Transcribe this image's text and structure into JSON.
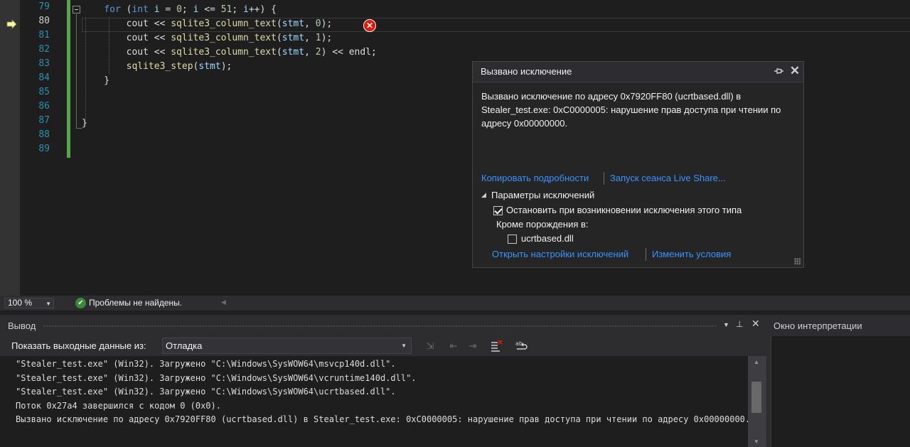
{
  "editor": {
    "line_numbers": [
      "79",
      "80",
      "81",
      "82",
      "83",
      "84",
      "85",
      "86",
      "87",
      "88",
      "89"
    ],
    "current_line": "80",
    "lines": [
      [
        {
          "t": "    "
        },
        {
          "t": "for",
          "c": "kw"
        },
        {
          "t": " ("
        },
        {
          "t": "int",
          "c": "kw"
        },
        {
          "t": " "
        },
        {
          "t": "i",
          "c": "var"
        },
        {
          "t": " = "
        },
        {
          "t": "0",
          "c": "num"
        },
        {
          "t": "; "
        },
        {
          "t": "i",
          "c": "var"
        },
        {
          "t": " <= "
        },
        {
          "t": "51",
          "c": "num"
        },
        {
          "t": "; "
        },
        {
          "t": "i",
          "c": "var"
        },
        {
          "t": "++) {"
        }
      ],
      [
        {
          "t": "        cout << "
        },
        {
          "t": "sqlite3_column_text",
          "c": "fn"
        },
        {
          "t": "("
        },
        {
          "t": "stmt",
          "c": "var"
        },
        {
          "t": ", "
        },
        {
          "t": "0",
          "c": "num"
        },
        {
          "t": ");"
        }
      ],
      [
        {
          "t": "        cout << "
        },
        {
          "t": "sqlite3_column_text",
          "c": "fn"
        },
        {
          "t": "("
        },
        {
          "t": "stmt",
          "c": "var"
        },
        {
          "t": ", "
        },
        {
          "t": "1",
          "c": "num"
        },
        {
          "t": ");"
        }
      ],
      [
        {
          "t": "        cout << "
        },
        {
          "t": "sqlite3_column_text",
          "c": "fn"
        },
        {
          "t": "("
        },
        {
          "t": "stmt",
          "c": "var"
        },
        {
          "t": ", "
        },
        {
          "t": "2",
          "c": "num"
        },
        {
          "t": ") << endl;"
        }
      ],
      [
        {
          "t": "        "
        },
        {
          "t": "sqlite3_step",
          "c": "fn"
        },
        {
          "t": "("
        },
        {
          "t": "stmt",
          "c": "var"
        },
        {
          "t": ");"
        }
      ],
      [
        {
          "t": "    }"
        }
      ],
      [
        {
          "t": ""
        }
      ],
      [
        {
          "t": ""
        }
      ],
      [
        {
          "t": "}"
        }
      ],
      [
        {
          "t": ""
        }
      ],
      [
        {
          "t": ""
        }
      ]
    ]
  },
  "exception": {
    "title": "Вызвано исключение",
    "message": "Вызвано исключение по адресу 0x7920FF80 (ucrtbased.dll) в Stealer_test.exe: 0xC0000005: нарушение прав доступа при чтении по адресу 0x00000000.",
    "link_copy": "Копировать подробности",
    "link_liveshare": "Запуск сеанса Live Share...",
    "params_title": "Параметры исключений",
    "break_label": "Остановить при возникновении исключения этого типа",
    "break_checked": true,
    "except_label": "Кроме порождения в:",
    "module_label": "ucrtbased.dll",
    "module_checked": false,
    "link_settings": "Открыть настройки исключений",
    "link_conditions": "Изменить условия",
    "pin_icon": "pin-icon",
    "close_icon": "close-icon"
  },
  "status": {
    "zoom": "100 %",
    "problems": "Проблемы не найдены."
  },
  "output": {
    "title": "Вывод",
    "source_label": "Показать выходные данные из:",
    "source_value": "Отладка",
    "lines": [
      "\"Stealer_test.exe\" (Win32). Загружено \"C:\\Windows\\SysWOW64\\msvcp140d.dll\".",
      "\"Stealer_test.exe\" (Win32). Загружено \"C:\\Windows\\SysWOW64\\vcruntime140d.dll\".",
      "\"Stealer_test.exe\" (Win32). Загружено \"C:\\Windows\\SysWOW64\\ucrtbased.dll\".",
      "Поток 0x27a4 завершился с кодом 0 (0x0).",
      "Вызвано исключение по адресу 0x7920FF80 (ucrtbased.dll) в Stealer_test.exe: 0xC0000005: нарушение прав доступа при чтении по адресу 0x00000000."
    ]
  },
  "interpret": {
    "title": "Окно интерпретации"
  },
  "colors": {
    "editor_bg": "#1e1e1e",
    "keyword": "#569cd6",
    "function": "#dcdcaa",
    "variable": "#9cdcfe",
    "number": "#b5cea8",
    "line_number": "#2b91af",
    "link": "#3794ff",
    "error": "#e51400",
    "ok": "#388a34",
    "change_bar": "#57a64a"
  }
}
